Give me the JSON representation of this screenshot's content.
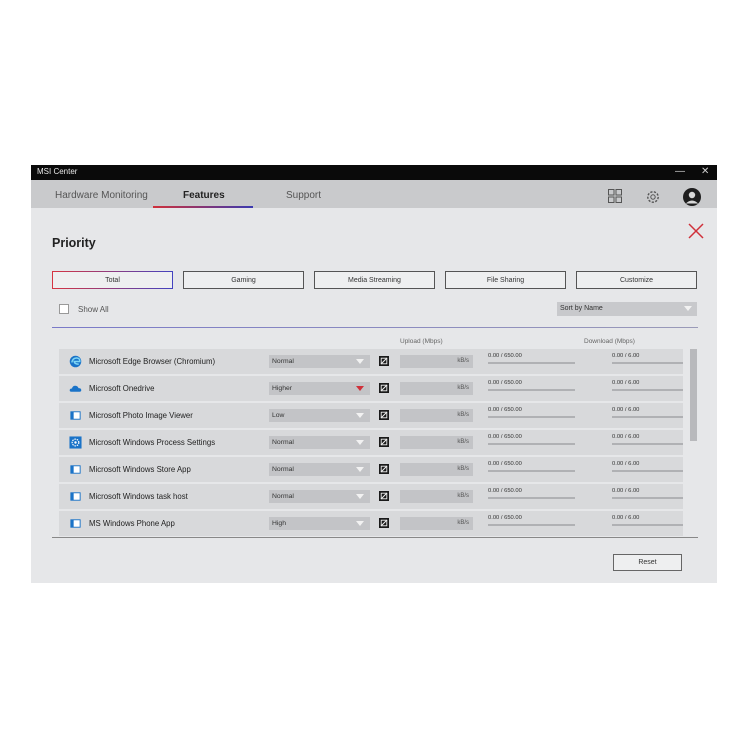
{
  "window": {
    "title": "MSI Center",
    "minimize": "—",
    "close": "✕"
  },
  "nav": {
    "tabs": [
      {
        "label": "Hardware Monitoring"
      },
      {
        "label": "Features"
      },
      {
        "label": "Support"
      }
    ],
    "icons": [
      "apps-grid-icon",
      "gear-icon",
      "user-avatar-icon"
    ]
  },
  "page": {
    "title": "Priority"
  },
  "filters": [
    "Total",
    "Gaming",
    "Media Streaming",
    "File Sharing",
    "Customize"
  ],
  "active_filter": "Total",
  "show_all_label": "Show All",
  "sort": {
    "value": "Sort by Name"
  },
  "columns": {
    "upload": "Upload (Mbps)",
    "download": "Download (Mbps)"
  },
  "rows": [
    {
      "name": "Microsoft Edge Browser (Chromium)",
      "icon": "edge-icon",
      "priority": "Normal",
      "unit": "kB/s",
      "upload": "0.00 / 650.00",
      "download": "0.00 / 6.00"
    },
    {
      "name": "Microsoft Onedrive",
      "icon": "onedrive-cloud-icon",
      "priority": "Higher",
      "unit": "kB/s",
      "upload": "0.00 / 650.00",
      "download": "0.00 / 6.00"
    },
    {
      "name": "Microsoft Photo Image Viewer",
      "icon": "app-window-icon",
      "priority": "Low",
      "unit": "kB/s",
      "upload": "0.00 / 650.00",
      "download": "0.00 / 6.00"
    },
    {
      "name": "Microsoft Windows Process Settings",
      "icon": "settings-gear-icon",
      "priority": "Normal",
      "unit": "kB/s",
      "upload": "0.00 / 650.00",
      "download": "0.00 / 6.00"
    },
    {
      "name": "Microsoft Windows Store App",
      "icon": "app-window-icon",
      "priority": "Normal",
      "unit": "kB/s",
      "upload": "0.00 / 650.00",
      "download": "0.00 / 6.00"
    },
    {
      "name": "Microsoft Windows task host",
      "icon": "app-window-icon",
      "priority": "Normal",
      "unit": "kB/s",
      "upload": "0.00 / 650.00",
      "download": "0.00 / 6.00"
    },
    {
      "name": "MS Windows Phone App",
      "icon": "app-window-icon",
      "priority": "High",
      "unit": "kB/s",
      "upload": "0.00 / 650.00",
      "download": "0.00 / 6.00"
    }
  ],
  "reset_label": "Reset",
  "colors": {
    "accent_red": "#d0303a",
    "accent_blue": "#3a3ab0",
    "titlebar": "#0a0a0a",
    "icon_blue": "#1a73c8"
  }
}
